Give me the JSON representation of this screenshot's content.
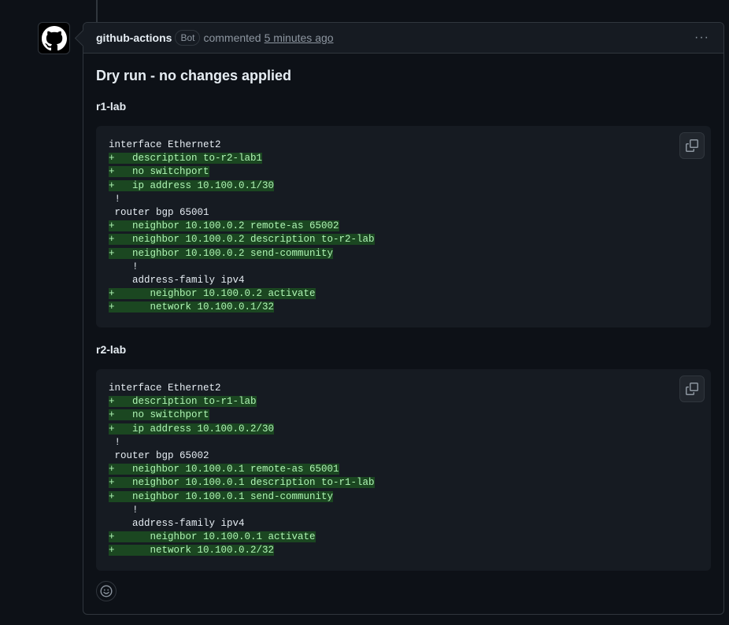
{
  "comment": {
    "author": "github-actions",
    "badge": "Bot",
    "action": "commented",
    "timestamp": "5 minutes ago",
    "menu_glyph": "···",
    "title": "Dry run - no changes applied"
  },
  "sections": [
    {
      "name": "r1-lab",
      "lines": [
        {
          "text": "interface Ethernet2",
          "added": false
        },
        {
          "text": "+   description to-r2-lab1",
          "added": true
        },
        {
          "text": "+   no switchport",
          "added": true
        },
        {
          "text": "+   ip address 10.100.0.1/30",
          "added": true
        },
        {
          "text": " !",
          "added": false
        },
        {
          "text": " router bgp 65001",
          "added": false
        },
        {
          "text": "+   neighbor 10.100.0.2 remote-as 65002",
          "added": true
        },
        {
          "text": "+   neighbor 10.100.0.2 description to-r2-lab",
          "added": true
        },
        {
          "text": "+   neighbor 10.100.0.2 send-community",
          "added": true
        },
        {
          "text": "    !",
          "added": false
        },
        {
          "text": "    address-family ipv4",
          "added": false
        },
        {
          "text": "+      neighbor 10.100.0.2 activate",
          "added": true
        },
        {
          "text": "+      network 10.100.0.1/32",
          "added": true
        }
      ]
    },
    {
      "name": "r2-lab",
      "lines": [
        {
          "text": "interface Ethernet2",
          "added": false
        },
        {
          "text": "+   description to-r1-lab",
          "added": true
        },
        {
          "text": "+   no switchport",
          "added": true
        },
        {
          "text": "+   ip address 10.100.0.2/30",
          "added": true
        },
        {
          "text": " !",
          "added": false
        },
        {
          "text": " router bgp 65002",
          "added": false
        },
        {
          "text": "+   neighbor 10.100.0.1 remote-as 65001",
          "added": true
        },
        {
          "text": "+   neighbor 10.100.0.1 description to-r1-lab",
          "added": true
        },
        {
          "text": "+   neighbor 10.100.0.1 send-community",
          "added": true
        },
        {
          "text": "    !",
          "added": false
        },
        {
          "text": "    address-family ipv4",
          "added": false
        },
        {
          "text": "+      neighbor 10.100.0.1 activate",
          "added": true
        },
        {
          "text": "+      network 10.100.0.2/32",
          "added": true
        }
      ]
    }
  ],
  "icons": {
    "avatar": "github-logo-icon",
    "copy": "copy-icon",
    "reaction": "smiley-icon"
  },
  "colors": {
    "background": "#0d1117",
    "code_background": "#161b22",
    "added_background": "#1b4721",
    "added_text": "#aff5b4",
    "border": "#30363d",
    "muted_text": "#8d96a0"
  }
}
